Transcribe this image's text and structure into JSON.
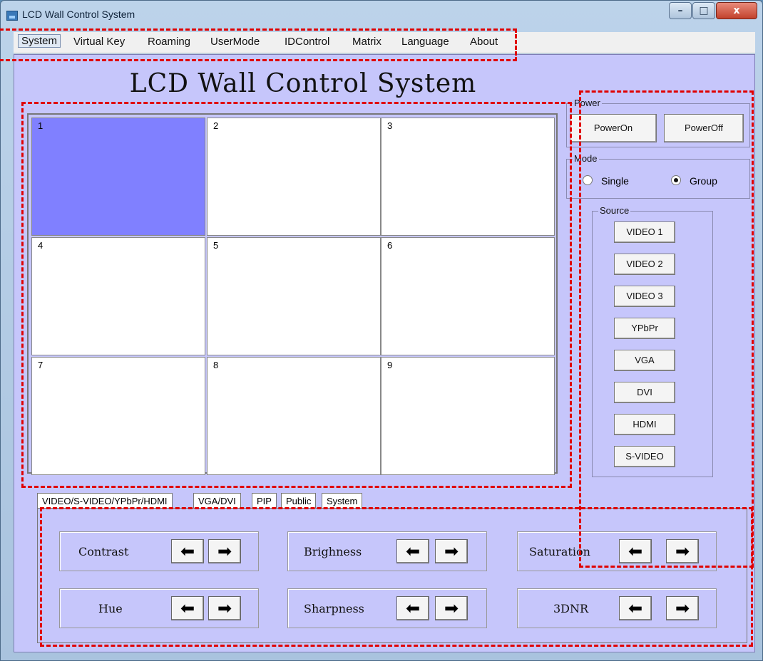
{
  "window": {
    "title": "LCD Wall Control System"
  },
  "menu": [
    "System",
    "Virtual Key",
    "Roaming",
    "UserMode",
    "IDControl",
    "Matrix",
    "Language",
    "About"
  ],
  "main_title": "LCD Wall Control System",
  "grid": {
    "cells": [
      "1",
      "2",
      "3",
      "4",
      "5",
      "6",
      "7",
      "8",
      "9"
    ],
    "selected": "1"
  },
  "power": {
    "label": "Power",
    "on": "PowerOn",
    "off": "PowerOff"
  },
  "mode": {
    "label": "Mode",
    "single": "Single",
    "group": "Group",
    "selected": "Group"
  },
  "source": {
    "label": "Source",
    "items": [
      "VIDEO 1",
      "VIDEO 2",
      "VIDEO 3",
      "YPbPr",
      "VGA",
      "DVI",
      "HDMI",
      "S-VIDEO"
    ]
  },
  "tabs": [
    "VIDEO/S-VIDEO/YPbPr/HDMI",
    "VGA/DVI",
    "PIP",
    "Public",
    "System"
  ],
  "controls": [
    "Contrast",
    "Brighness",
    "Saturation",
    "Hue",
    "Sharpness",
    "3DNR"
  ],
  "icons": {
    "left": "left-arrow-icon",
    "right": "right-arrow-icon"
  },
  "colors": {
    "client_bg": "#c6c6fb",
    "selected_cell": "#8080ff",
    "annotation": "#e00000"
  }
}
